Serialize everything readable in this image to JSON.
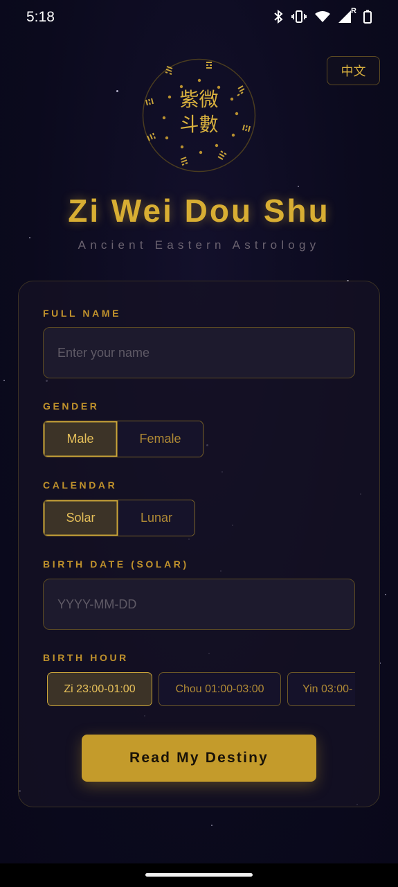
{
  "status_bar": {
    "time": "5:18",
    "icons": [
      "bluetooth-icon",
      "vibrate-icon",
      "wifi-icon",
      "signal-icon",
      "battery-icon"
    ],
    "roaming_label": "R"
  },
  "language_toggle": {
    "label": "中文"
  },
  "emblem": {
    "line1": "紫微",
    "line2": "斗數"
  },
  "header": {
    "title": "Zi Wei Dou Shu",
    "subtitle": "Ancient Eastern Astrology"
  },
  "form": {
    "full_name": {
      "label": "FULL NAME",
      "placeholder": "Enter your name",
      "value": ""
    },
    "gender": {
      "label": "GENDER",
      "options": [
        "Male",
        "Female"
      ],
      "selected": "Male"
    },
    "calendar": {
      "label": "CALENDAR",
      "options": [
        "Solar",
        "Lunar"
      ],
      "selected": "Solar"
    },
    "birth_date": {
      "label": "BIRTH DATE (SOLAR)",
      "placeholder": "YYYY-MM-DD",
      "value": ""
    },
    "birth_hour": {
      "label": "BIRTH HOUR",
      "options": [
        "Zi 23:00-01:00",
        "Chou 01:00-03:00",
        "Yin 03:00-"
      ],
      "selected": "Zi 23:00-01:00"
    },
    "submit_label": "Read My Destiny"
  },
  "colors": {
    "background": "#0c0a1f",
    "accent_gold": "#c49b2b",
    "card_border": "#3b3224"
  }
}
